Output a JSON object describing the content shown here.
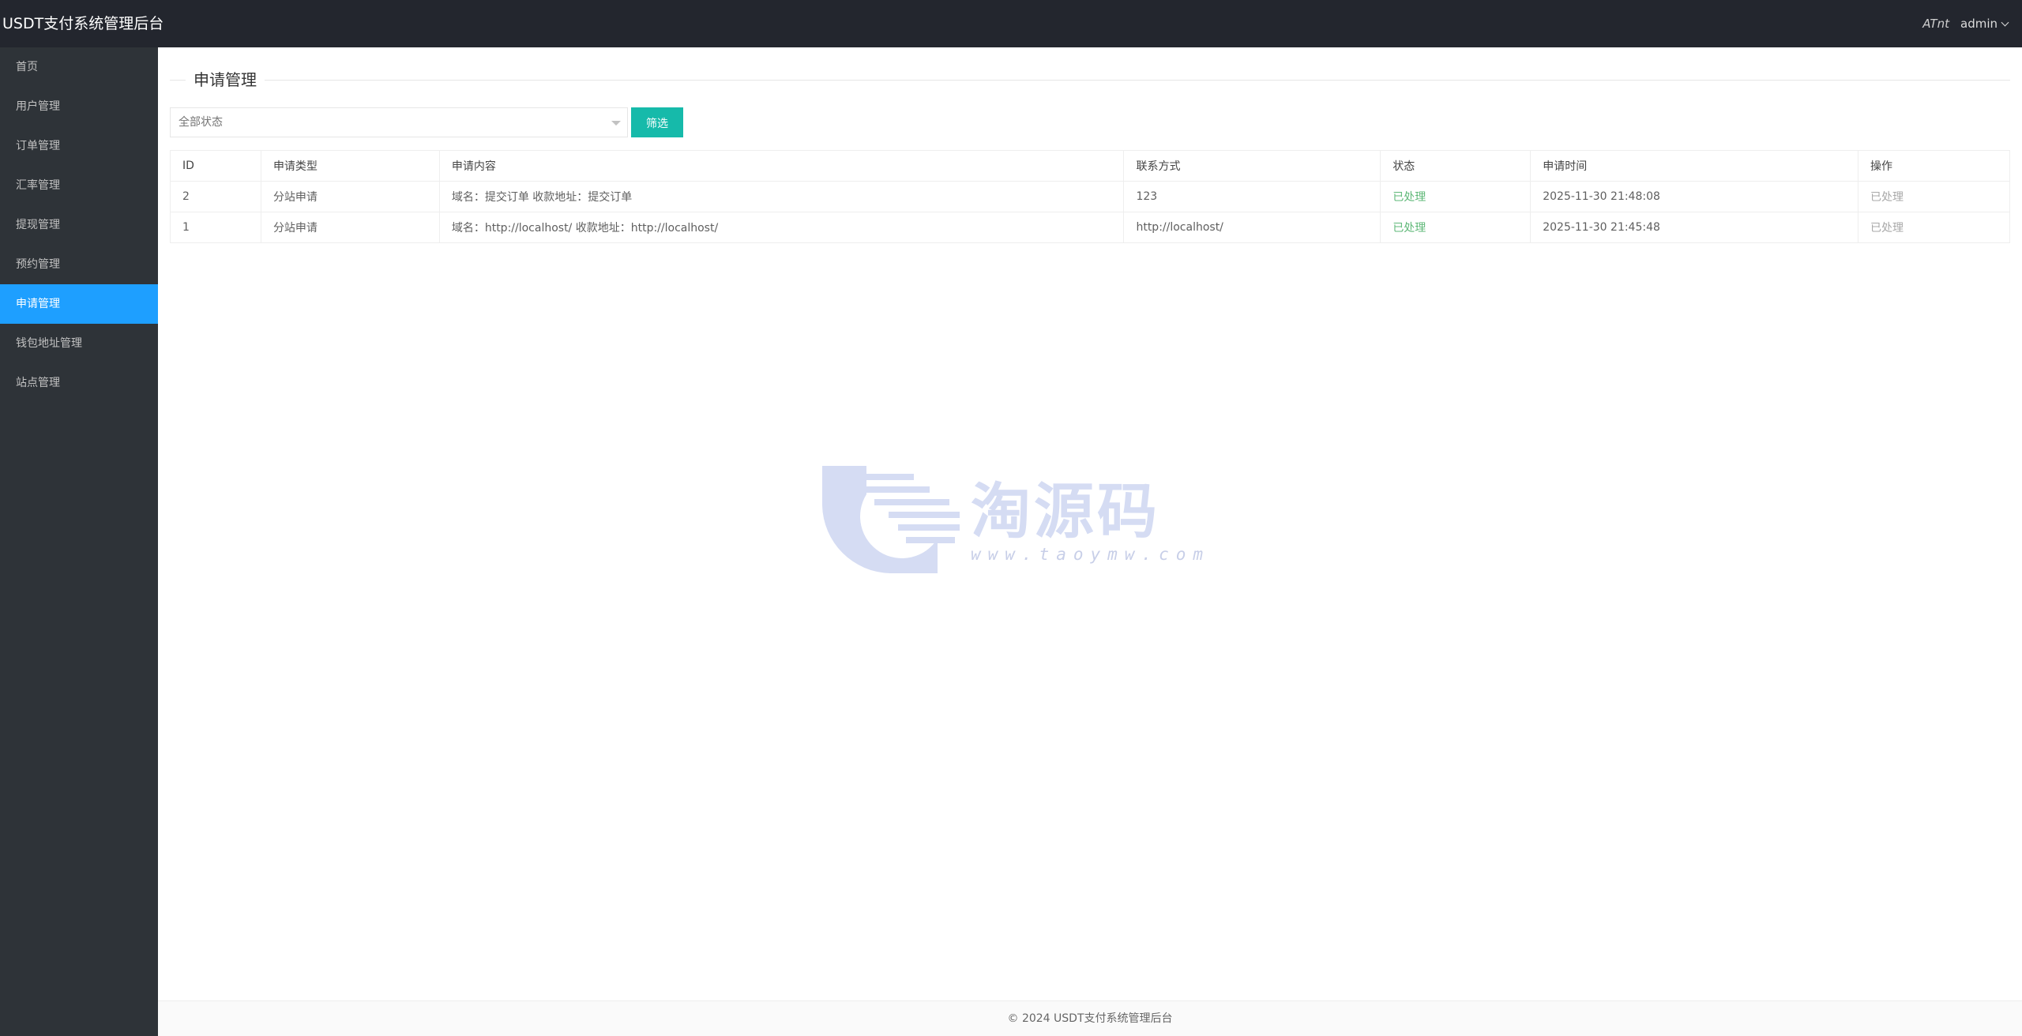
{
  "header": {
    "title": "USDT支付系统管理后台",
    "icon_label": "ATnt",
    "user": "admin"
  },
  "sidebar": {
    "items": [
      {
        "label": "首页"
      },
      {
        "label": "用户管理"
      },
      {
        "label": "订单管理"
      },
      {
        "label": "汇率管理"
      },
      {
        "label": "提现管理"
      },
      {
        "label": "预约管理"
      },
      {
        "label": "申请管理",
        "active": true
      },
      {
        "label": "钱包地址管理"
      },
      {
        "label": "站点管理"
      }
    ]
  },
  "main": {
    "title": "申请管理",
    "filter": {
      "selected": "全部状态",
      "button_label": "筛选"
    },
    "table": {
      "headers": [
        "ID",
        "申请类型",
        "申请内容",
        "联系方式",
        "状态",
        "申请时间",
        "操作"
      ],
      "rows": [
        [
          "2",
          "分站申请",
          "域名：提交订单 收款地址：提交订单",
          "123",
          "已处理",
          "2025-11-30 21:48:08",
          "已处理"
        ],
        [
          "1",
          "分站申请",
          "域名：http://localhost/ 收款地址：http://localhost/",
          "http://localhost/",
          "已处理",
          "2025-11-30 21:45:48",
          "已处理"
        ]
      ]
    }
  },
  "watermark": {
    "text": "淘源码",
    "url": "www.taoymw.com"
  },
  "footer": {
    "text": "© 2024 USDT支付系统管理后台"
  },
  "colors": {
    "header_bg": "#23262e",
    "sidebar_bg": "#2e3338",
    "active_bg": "#1e9fff",
    "button_bg": "#16baaa",
    "status_green": "#5fb878"
  }
}
